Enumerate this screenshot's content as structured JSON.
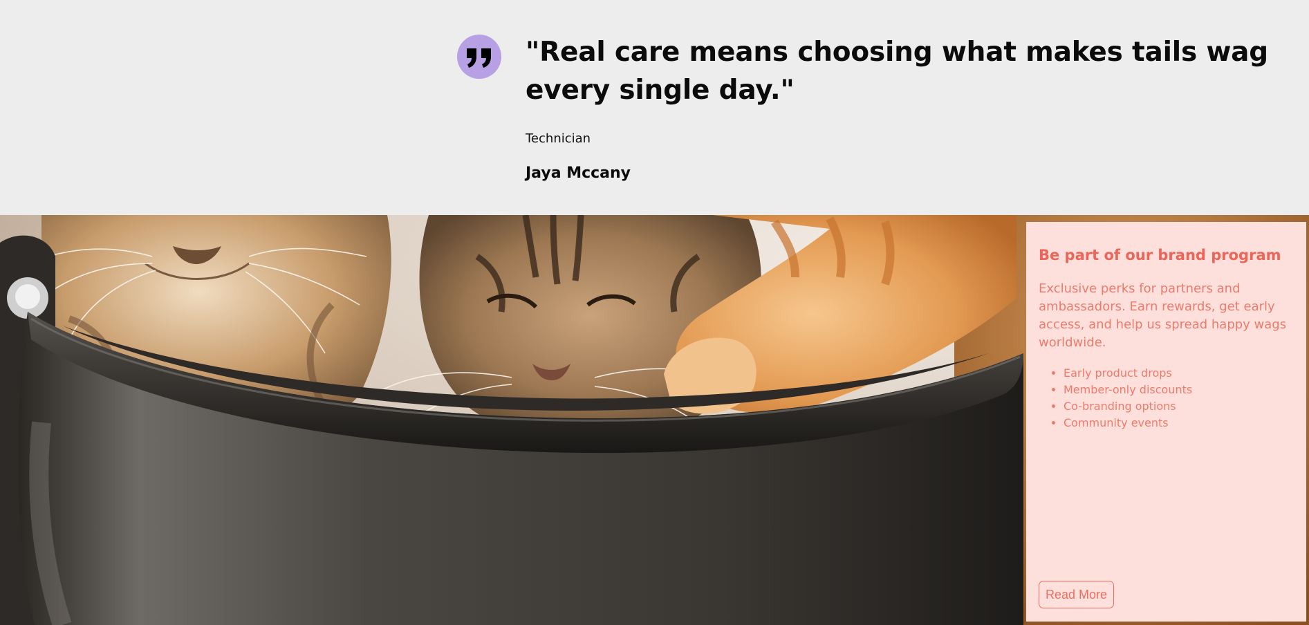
{
  "testimonial": {
    "quote": "\"Real care means choosing what makes tails wag every single day.\"",
    "role": "Technician",
    "name": "Jaya Mccany",
    "quote_icon": "quote-mark-icon",
    "accent_color": "#b8a0e4"
  },
  "hero": {
    "image_subject": "three cats in a dark bowl-shaped pet bed"
  },
  "brand_program": {
    "title": "Be part of our brand program",
    "description": "Exclusive perks for partners and ambassadors. Earn rewards, get early access, and help us spread happy wags worldwide.",
    "perks": [
      "Early product drops",
      "Member-only discounts",
      "Co-branding options",
      "Community events"
    ],
    "button_label": "Read More",
    "text_color": "#ec6e60",
    "background_color": "#fde0db"
  }
}
